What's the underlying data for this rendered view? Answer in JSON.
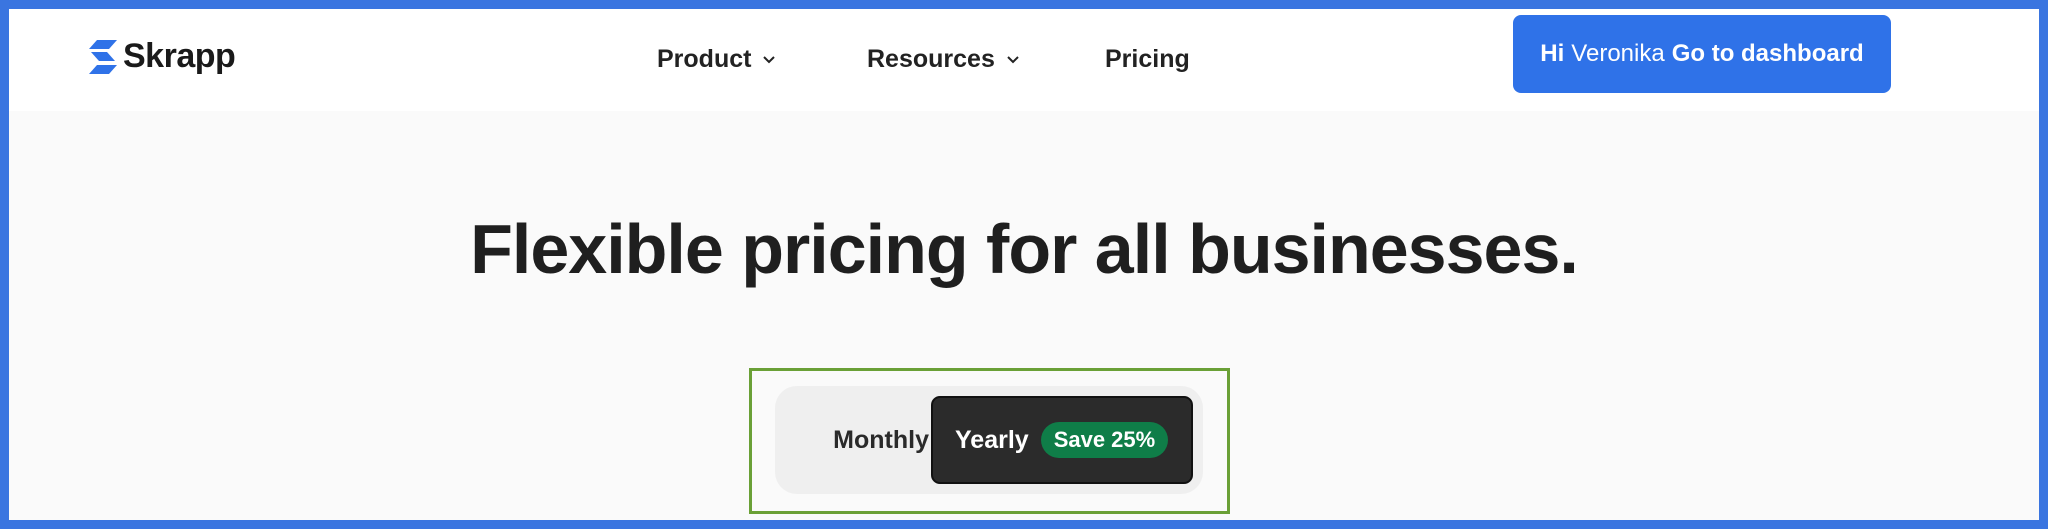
{
  "logo": {
    "text": "Skrapp",
    "icon": "skrapp-logo-icon"
  },
  "nav": {
    "items": [
      {
        "label": "Product",
        "has_dropdown": true
      },
      {
        "label": "Resources",
        "has_dropdown": true
      },
      {
        "label": "Pricing",
        "has_dropdown": false
      }
    ]
  },
  "cta": {
    "greeting": "Hi",
    "user_name": "Veronika",
    "action": "Go to dashboard"
  },
  "hero": {
    "headline": "Flexible pricing for all businesses."
  },
  "billing_toggle": {
    "monthly_label": "Monthly",
    "yearly_label": "Yearly",
    "yearly_badge": "Save 25%",
    "selected": "Yearly"
  },
  "colors": {
    "frame": "#3a75e0",
    "brand_blue": "#2f72e8",
    "highlight": "#6aa036",
    "badge_green": "#0f7d48",
    "toggle_active": "#2b2b2b"
  }
}
